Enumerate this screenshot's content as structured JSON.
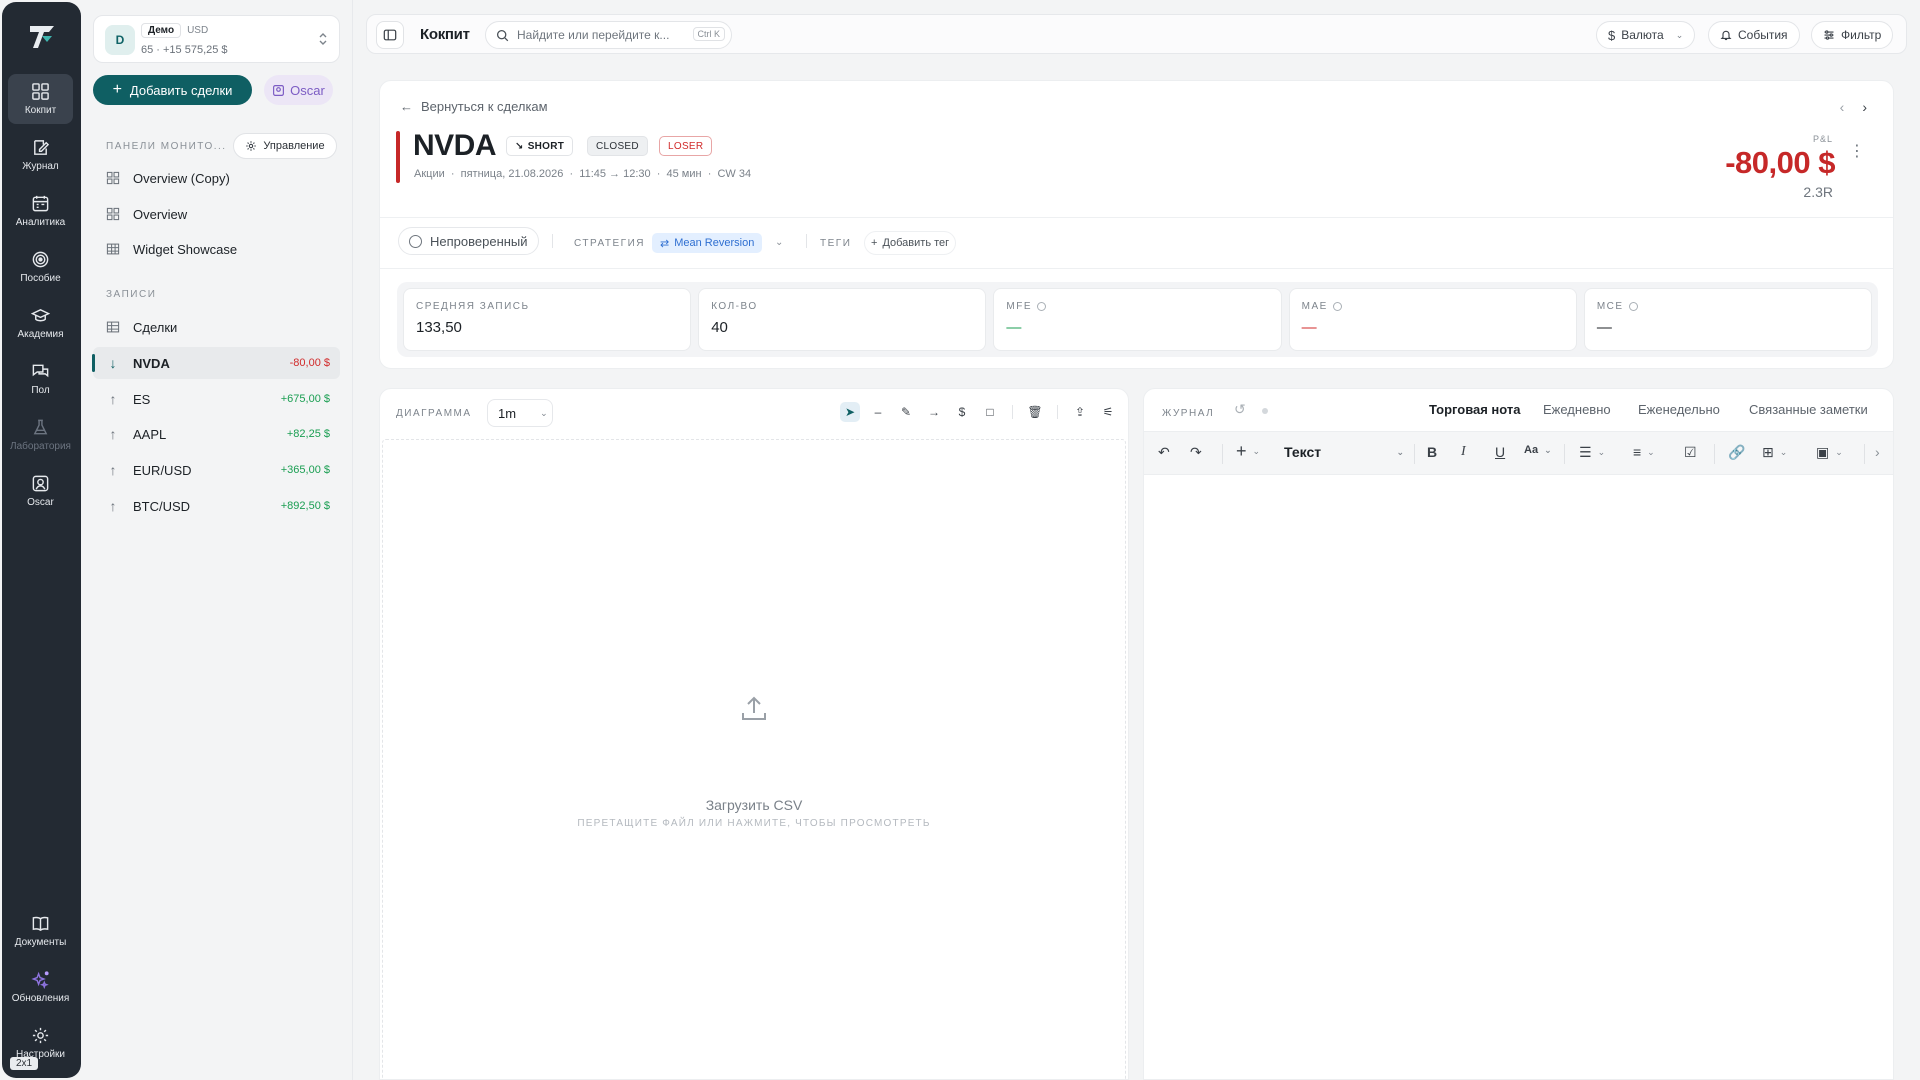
{
  "rail": {
    "items": [
      {
        "label": "Кокпит",
        "icon": "grid-icon"
      },
      {
        "label": "Журнал",
        "icon": "journal-edit-icon"
      },
      {
        "label": "Аналитика",
        "icon": "calendar-chart-icon"
      },
      {
        "label": "Пособие",
        "icon": "target-icon"
      },
      {
        "label": "Академия",
        "icon": "graduation-cap-icon"
      },
      {
        "label": "Пол",
        "icon": "chat-bubbles-icon"
      },
      {
        "label": "Лаборатория",
        "icon": "flask-icon"
      },
      {
        "label": "Oscar",
        "icon": "robot-avatar-icon"
      },
      {
        "label": "Документы",
        "icon": "book-open-icon"
      },
      {
        "label": "Обновления",
        "icon": "sparkles-icon"
      },
      {
        "label": "Настройки",
        "icon": "gear-icon"
      }
    ],
    "badge": "2x1"
  },
  "account": {
    "avatar": "D",
    "name": "Демо",
    "currency": "USD",
    "balance": "65 · +15 575,25 $"
  },
  "sidebar": {
    "add_trades": "Добавить сделки",
    "oscar": "Oscar",
    "panels_label": "ПАНЕЛИ МОНИТО...",
    "manage": "Управление",
    "panels": [
      "Overview (Copy)",
      "Overview",
      "Widget Showcase"
    ],
    "records_label": "ЗАПИСИ",
    "trades": "Сделки",
    "records": [
      {
        "symbol": "NVDA",
        "pnl": "-80,00 $",
        "dir": "down",
        "active": true
      },
      {
        "symbol": "ES",
        "pnl": "+675,00 $",
        "dir": "up"
      },
      {
        "symbol": "AAPL",
        "pnl": "+82,25 $",
        "dir": "up"
      },
      {
        "symbol": "EUR/USD",
        "pnl": "+365,00 $",
        "dir": "up"
      },
      {
        "symbol": "BTC/USD",
        "pnl": "+892,50 $",
        "dir": "up"
      }
    ]
  },
  "topbar": {
    "title": "Кокпит",
    "search_placeholder": "Найдите или перейдите к...",
    "shortcut": "Ctrl K",
    "currency": "Валюта",
    "events": "События",
    "filter": "Фильтр"
  },
  "trade": {
    "back": "Вернуться к сделкам",
    "symbol": "NVDA",
    "side": "SHORT",
    "status": "CLOSED",
    "result": "LOSER",
    "meta": "Акции  ·  пятница, 21.08.2026  ·  11:45 → 12:30  ·  45 мин  ·  CW 34",
    "pnl_label": "P&L",
    "pnl": "-80,00 $",
    "r_multiple": "2.3R",
    "verification": "Непроверенный",
    "strategy_label": "СТРАТЕГИЯ",
    "strategy": "Mean Reversion",
    "tags_label": "ТЕГИ",
    "add_tag": "Добавить тег",
    "stats": [
      {
        "label": "СРЕДНЯЯ ЗАПИСЬ",
        "value": "133,50",
        "info": false,
        "tone": ""
      },
      {
        "label": "КОЛ-ВО",
        "value": "40",
        "info": false,
        "tone": ""
      },
      {
        "label": "MFE",
        "value": "—",
        "info": true,
        "tone": "green"
      },
      {
        "label": "MAE",
        "value": "—",
        "info": true,
        "tone": "red"
      },
      {
        "label": "MCE",
        "value": "—",
        "info": true,
        "tone": ""
      }
    ]
  },
  "chart_panel": {
    "label": "ДИАГРАММА",
    "timeframe": "1m",
    "upload_title": "Загрузить CSV",
    "upload_hint": "ПЕРЕТАЩИТЕ ФАЙЛ ИЛИ НАЖМИТЕ, ЧТОБЫ ПРОСМОТРЕТЬ"
  },
  "journal": {
    "label": "ЖУРНАЛ",
    "tabs": [
      "Торговая нота",
      "Ежедневно",
      "Еженедельно",
      "Связанные заметки"
    ],
    "block_type": "Текст"
  },
  "colors": {
    "accent": "#0f5f63",
    "loss": "#d12a2a",
    "gain": "#1a9e52",
    "rail": "#232a33"
  }
}
